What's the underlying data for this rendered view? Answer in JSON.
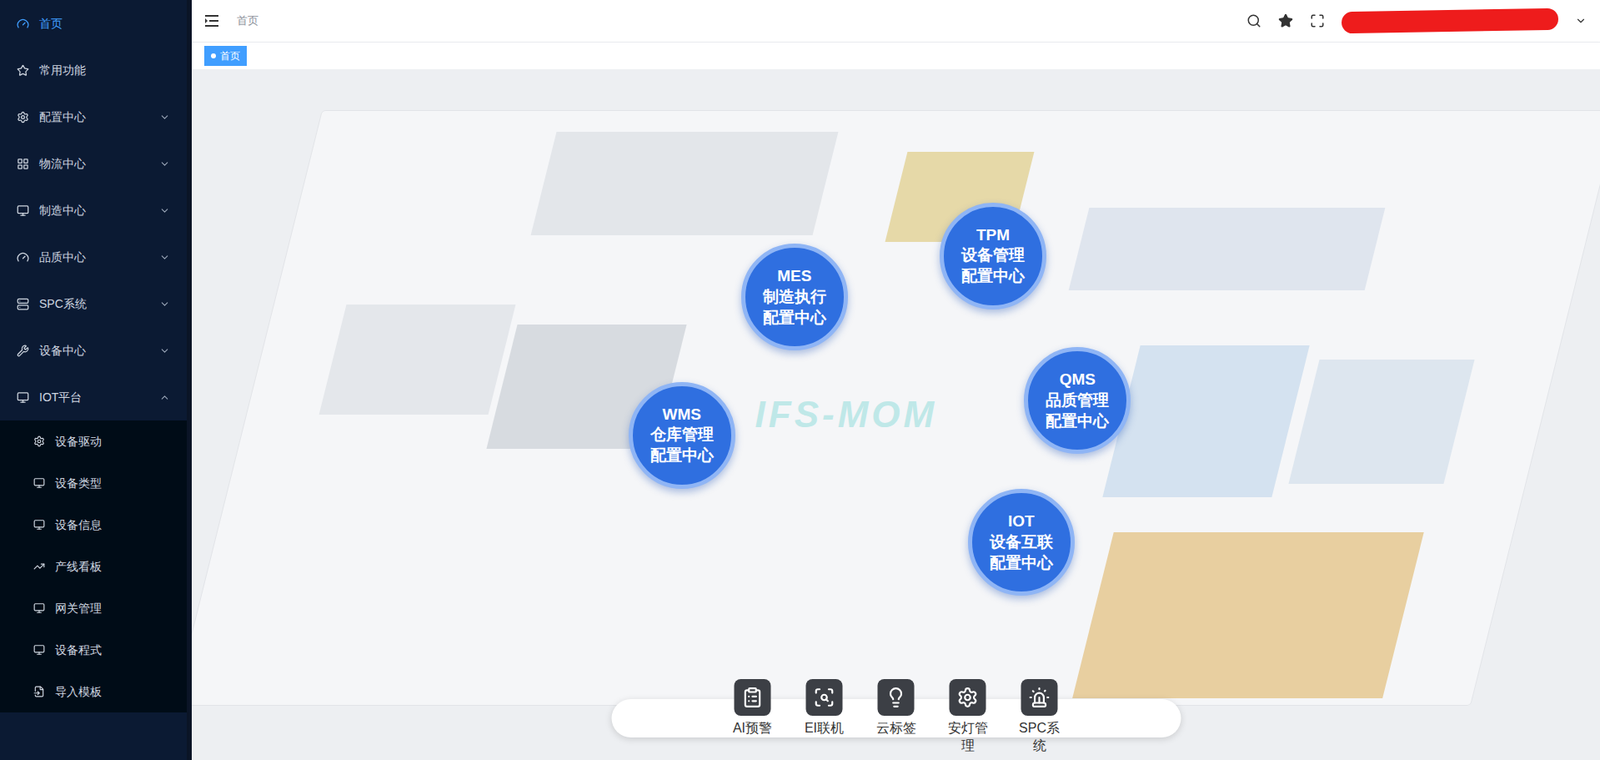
{
  "header": {
    "breadcrumb": "首页"
  },
  "tags": [
    {
      "label": "首页",
      "selected": true
    }
  ],
  "sidebar": {
    "items": [
      {
        "label": "首页",
        "kind": "link",
        "selected": true,
        "expanded": false
      },
      {
        "label": "常用功能",
        "kind": "link",
        "selected": false,
        "expanded": false
      },
      {
        "label": "配置中心",
        "kind": "group",
        "selected": false,
        "expanded": false
      },
      {
        "label": "物流中心",
        "kind": "group",
        "selected": false,
        "expanded": false
      },
      {
        "label": "制造中心",
        "kind": "group",
        "selected": false,
        "expanded": false
      },
      {
        "label": "品质中心",
        "kind": "group",
        "selected": false,
        "expanded": false
      },
      {
        "label": "SPC系统",
        "kind": "group",
        "selected": false,
        "expanded": false
      },
      {
        "label": "设备中心",
        "kind": "group",
        "selected": false,
        "expanded": false
      },
      {
        "label": "IOT平台",
        "kind": "group",
        "selected": false,
        "expanded": true,
        "children": [
          {
            "label": "设备驱动",
            "selected": false
          },
          {
            "label": "设备类型",
            "selected": false
          },
          {
            "label": "设备信息",
            "selected": false
          },
          {
            "label": "产线看板",
            "selected": false
          },
          {
            "label": "网关管理",
            "selected": false
          },
          {
            "label": "设备程式",
            "selected": false
          },
          {
            "label": "导入模板",
            "selected": false
          }
        ]
      }
    ]
  },
  "canvas": {
    "watermark": "IFS-MOM",
    "hotspots": [
      {
        "code": "MES",
        "line1": "制造执行",
        "line2": "配置中心"
      },
      {
        "code": "TPM",
        "line1": "设备管理",
        "line2": "配置中心"
      },
      {
        "code": "QMS",
        "line1": "品质管理",
        "line2": "配置中心"
      },
      {
        "code": "WMS",
        "line1": "仓库管理",
        "line2": "配置中心"
      },
      {
        "code": "IOT",
        "line1": "设备互联",
        "line2": "配置中心"
      }
    ]
  },
  "dock": [
    {
      "label": "AI预警"
    },
    {
      "label": "EI联机"
    },
    {
      "label": "云标签"
    },
    {
      "label": "安灯管理"
    },
    {
      "label": "SPC系统"
    }
  ]
}
